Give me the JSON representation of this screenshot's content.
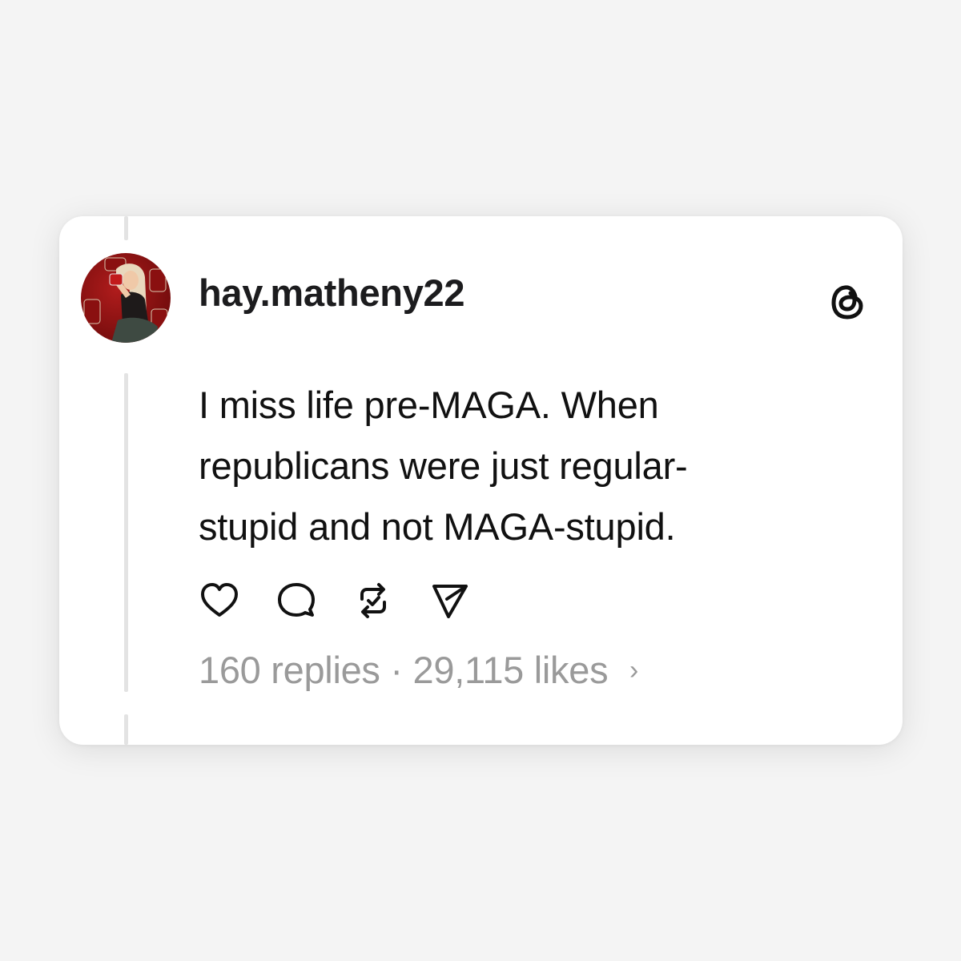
{
  "post": {
    "username": "hay.matheny22",
    "text_lines": [
      "I miss life pre-MAGA. When",
      "republicans were just regular-",
      "stupid and not MAGA-stupid."
    ],
    "replies": "160 replies",
    "separator": "·",
    "likes": "29,115 likes",
    "chevron": "›"
  },
  "icons": {
    "avatar": "avatar-illustration",
    "brand": "threads-logo-icon",
    "actions": [
      "heart-icon",
      "comment-icon",
      "repost-icon",
      "send-icon"
    ]
  },
  "colors": {
    "background": "#f4f4f4",
    "card": "#ffffff",
    "text": "#111111",
    "muted": "#9a9a9a",
    "thread_line": "#e3e3e3"
  }
}
